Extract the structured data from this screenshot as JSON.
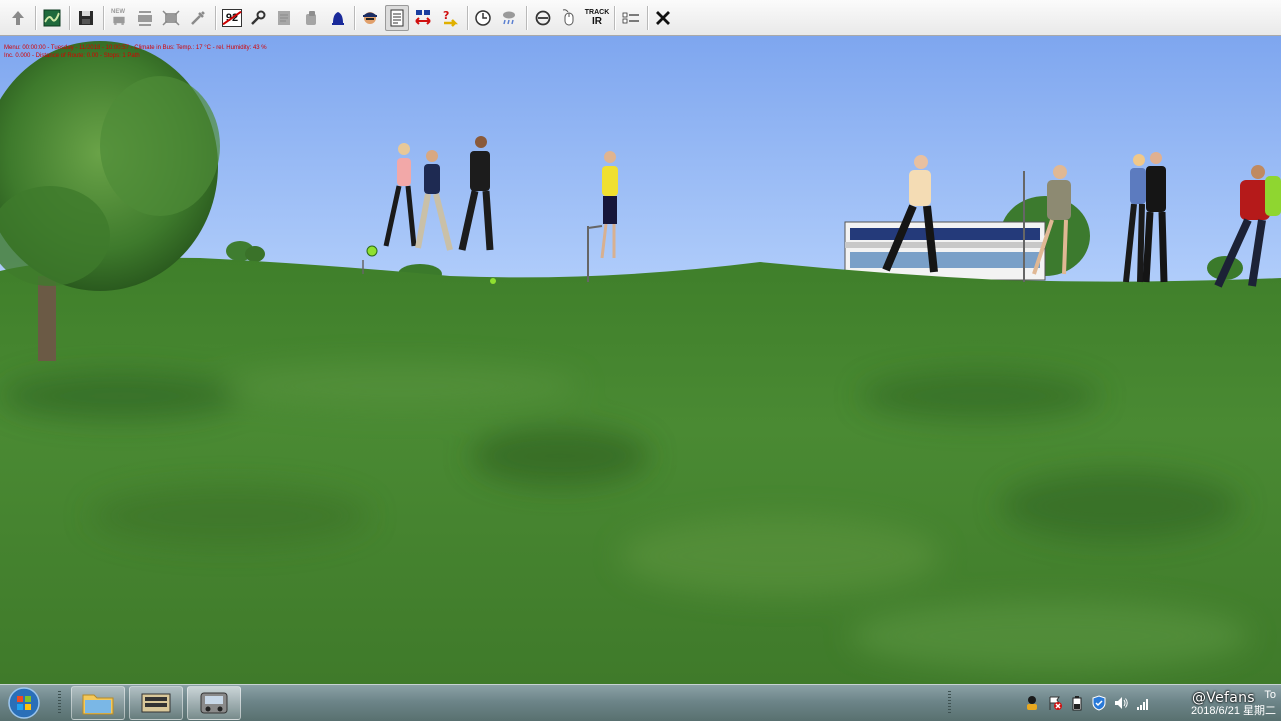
{
  "toolbar": {
    "buttons": [
      {
        "id": "up",
        "icon": "up-arrow-icon"
      },
      {
        "id": "map",
        "icon": "map-icon"
      },
      {
        "id": "save",
        "icon": "save-disk-icon"
      },
      {
        "id": "new",
        "icon": "new-object-icon",
        "label": "NEW"
      },
      {
        "id": "copy",
        "icon": "copy-object-icon"
      },
      {
        "id": "scale",
        "icon": "scale-object-icon"
      },
      {
        "id": "pick",
        "icon": "pick-tool-icon"
      },
      {
        "id": "bus-number",
        "icon": "bus-number-icon",
        "label": "92"
      },
      {
        "id": "wrench",
        "icon": "wrench-icon"
      },
      {
        "id": "doc-gray",
        "icon": "document-icon"
      },
      {
        "id": "sound",
        "icon": "sound-icon"
      },
      {
        "id": "bell",
        "icon": "bell-icon"
      },
      {
        "id": "driver",
        "icon": "driver-icon"
      },
      {
        "id": "timetable",
        "icon": "timetable-icon"
      },
      {
        "id": "transfer",
        "icon": "transfer-icon"
      },
      {
        "id": "help",
        "icon": "help-question-icon"
      },
      {
        "id": "clock",
        "icon": "clock-icon"
      },
      {
        "id": "weather",
        "icon": "weather-icon"
      },
      {
        "id": "compass",
        "icon": "compass-icon"
      },
      {
        "id": "mouse",
        "icon": "mouse-icon"
      },
      {
        "id": "track-ir",
        "icon": "track-ir-icon",
        "label_line1": "TRACK",
        "label_line2": "IR"
      },
      {
        "id": "options",
        "icon": "options-checkbox-icon"
      },
      {
        "id": "close",
        "icon": "close-x-icon"
      }
    ]
  },
  "hud": {
    "line1": "Menu: 00:00:00 - Tuesday - 11/2018 - 10:00:57 - Climate in Bus: Temp.: 17 °C - rel. Humidity: 43 %",
    "line2": "Inc. 0.000 - Distance of Route: 0.00 - Stops: 1 Path"
  },
  "taskbar": {
    "start_icon": "windows-start-icon",
    "items": [
      {
        "icon": "folder-icon"
      },
      {
        "icon": "omsi-bus-icon"
      },
      {
        "icon": "omsi-game-icon",
        "active": true
      }
    ],
    "tray_icons": [
      "person-icon",
      "flag-error-icon",
      "battery-icon",
      "shield-icon",
      "speaker-icon",
      "signal-bars-icon"
    ],
    "clock_time": "To",
    "clock_date": "2018/6/21 星期二",
    "watermark": "@Vefans"
  },
  "colors": {
    "sky_top": "#7ea6ef",
    "sky_bottom": "#b3cffb",
    "grass_light": "#4f8a32",
    "grass_dark": "#2f6a22",
    "hud_red": "#d40000"
  }
}
